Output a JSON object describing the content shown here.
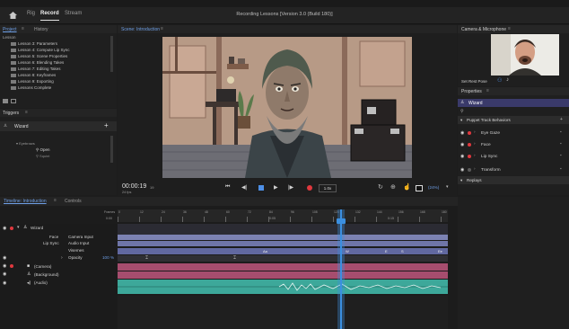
{
  "menubar": {
    "home_icon": "home-icon",
    "tabs": [
      "Rig",
      "Record",
      "Stream"
    ],
    "active_tab": "Record",
    "title": "Recording Lessons [Version 3.0 (Build 180)]"
  },
  "project_panel": {
    "tabs": [
      "Project",
      "History"
    ],
    "items": [
      "Lesson 3: Parameters",
      "Lesson 4: Compute Lip Sync",
      "Lesson 5: Scene Properties",
      "Lesson 6: Blending Takes",
      "Lesson 7: Editing Takes",
      "Lesson 8: Keyframes",
      "Lesson 9: Exporting",
      "Lessons Complete"
    ]
  },
  "triggers_panel": {
    "title": "Triggers",
    "puppet": "Wizard",
    "add_label": "+",
    "group_label": "Eyebrows",
    "options": [
      "Open",
      "Squint"
    ]
  },
  "scene": {
    "label": "Scene: Introduction",
    "menu_icon": "menu-icon"
  },
  "transport": {
    "timecode": "00:00:19",
    "frame": "19",
    "fps": "24 fps",
    "speed": "1.0x",
    "zoom": "(24%)"
  },
  "camera_panel": {
    "title": "Camera & Microphone",
    "rest_pose": "Set Rest Pose"
  },
  "properties_panel": {
    "title": "Properties",
    "puppet": "Wizard",
    "section": "Puppet Track Behaviors",
    "behaviors": [
      "Eye Gaze",
      "Face",
      "Lip Sync",
      "Transform"
    ],
    "replays": "Replays",
    "faded": [
      "Select Trigger Field",
      "Offset",
      "Off",
      "Can Rotate"
    ]
  },
  "timeline": {
    "tabs": [
      "Timeline: Introduction",
      "Controls"
    ],
    "ruler_labels": [
      "Frames",
      "0:00"
    ],
    "ticks": [
      "0",
      "12",
      "24",
      "36",
      "48",
      "60",
      "72",
      "84",
      "96",
      "108",
      "120",
      "132",
      "144",
      "156",
      "168",
      "180"
    ],
    "tracks": [
      {
        "name": "Wizard",
        "sub": ""
      },
      {
        "name": "Face",
        "sub": "Camera Input"
      },
      {
        "name": "Lip Sync",
        "sub": "Audio Input"
      },
      {
        "name": "",
        "sub": "Visemes"
      },
      {
        "name": "Opacity",
        "sub": "100 %"
      },
      {
        "name": "(Camera)",
        "sub": ""
      },
      {
        "name": "(Background)",
        "sub": ""
      },
      {
        "name": "(Audio)",
        "sub": ""
      }
    ],
    "viseme_labels": [
      "Aa",
      "W",
      "E",
      "S",
      "Ee"
    ],
    "marker_labels": [
      "0:05",
      "0:15"
    ]
  },
  "colors": {
    "accent": "#4d8fe6",
    "playhead": "#3b8fe0",
    "face_track": "#7c82b3",
    "lipsync_track": "#6f75a8",
    "camera_track": "#a64d6e",
    "audio_track": "#3da89a"
  }
}
